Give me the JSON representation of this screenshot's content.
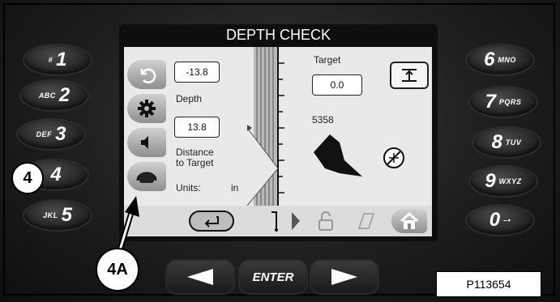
{
  "screen": {
    "title": "DEPTH CHECK",
    "depth_value": "-13.8",
    "depth_label": "Depth",
    "distance_value": "13.8",
    "distance_label_1": "Distance",
    "distance_label_2": "to Target",
    "units_label": "Units:",
    "units_value": "in",
    "target_label": "Target",
    "target_value": "0.0",
    "count_value": "5358"
  },
  "keypad_left": [
    {
      "small": "#",
      "big": "1"
    },
    {
      "small": "ABC",
      "big": "2"
    },
    {
      "small": "DEF",
      "big": "3"
    },
    {
      "small": "",
      "big": "4"
    },
    {
      "small": "JKL",
      "big": "5"
    }
  ],
  "keypad_right": [
    {
      "big": "6",
      "small": "MNO"
    },
    {
      "big": "7",
      "small": "PQRS"
    },
    {
      "big": "8",
      "small": "TUV"
    },
    {
      "big": "9",
      "small": "WXYZ"
    },
    {
      "big": "0",
      "small": "–•"
    }
  ],
  "nav": {
    "enter_label": "ENTER"
  },
  "callouts": {
    "key_callout": "4",
    "button_callout": "4A"
  },
  "figure_id": "P113654",
  "icons": {
    "sidebar": [
      "undo-icon",
      "gear-icon",
      "speaker-icon",
      "machine-icon"
    ],
    "bottom": [
      "return-icon",
      "plow-icon",
      "chevron-right-icon",
      "unlock-icon",
      "disabled-icon",
      "home-icon"
    ],
    "top_right": "target-set-icon",
    "compass": "no-signal-icon"
  },
  "colors": {
    "bezel": "#1e1e1e",
    "screen_bg": "#e9e9e9",
    "key_text": "#ffffff"
  }
}
